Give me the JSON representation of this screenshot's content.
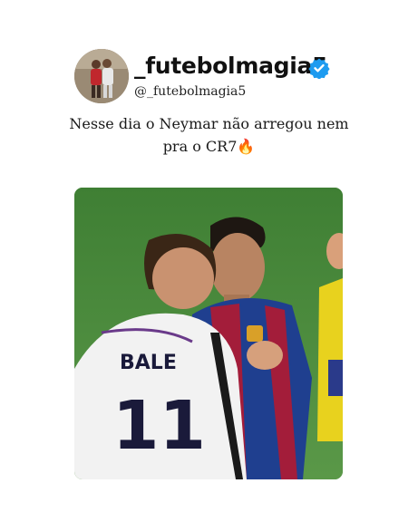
{
  "post": {
    "display_name": "_futebolmagia5",
    "handle": "@_futebolmagia5",
    "verified": true,
    "caption_line1": "Nesse dia o Neymar não arregou nem",
    "caption_line2": "pra o CR7🔥"
  },
  "photo": {
    "jersey_name": "BALE",
    "jersey_number": "11",
    "colors": {
      "pitch": "#4e8a3e",
      "barca_blue": "#1f3f8f",
      "barca_red": "#a31d3a",
      "referee_yellow": "#e8d21e"
    }
  },
  "icons": {
    "verified": "verified-badge-icon"
  },
  "colors": {
    "verified": "#1d9bf0",
    "text": "#111111"
  }
}
